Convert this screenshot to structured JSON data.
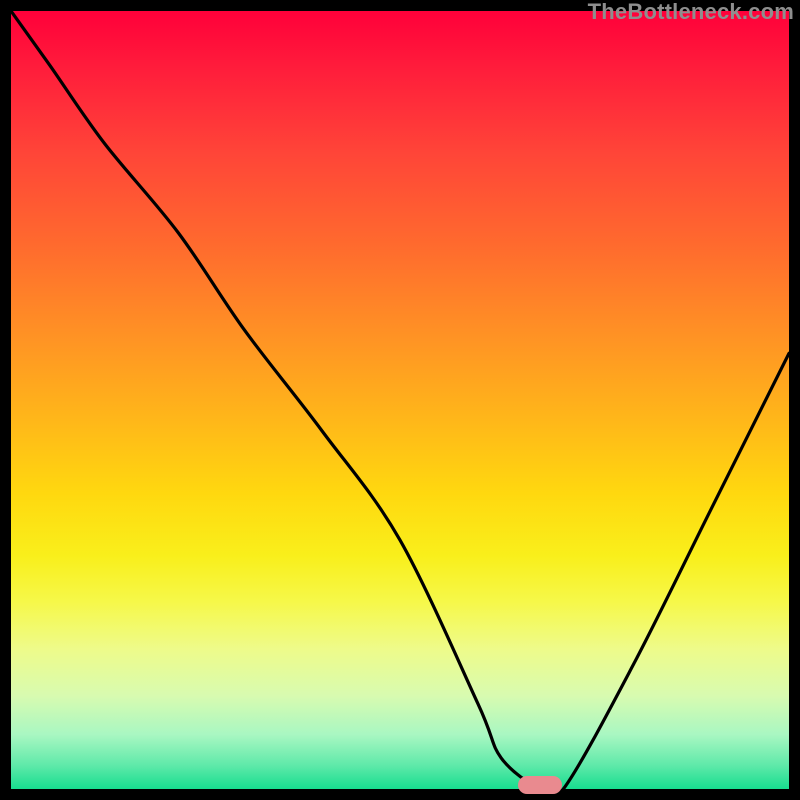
{
  "watermark": "TheBottleneck.com",
  "chart_data": {
    "type": "line",
    "title": "",
    "xlabel": "",
    "ylabel": "",
    "xlim": [
      0,
      100
    ],
    "ylim": [
      0,
      100
    ],
    "grid": false,
    "legend": false,
    "background": "rainbow-vertical-gradient",
    "series": [
      {
        "name": "bottleneck-curve",
        "x": [
          0,
          5,
          12,
          21.5,
          30,
          40,
          50,
          60,
          63,
          68,
          71,
          80,
          90,
          100
        ],
        "values": [
          100,
          93,
          83,
          71.5,
          59,
          46,
          32,
          11,
          4,
          0,
          0,
          16,
          36,
          56
        ]
      }
    ],
    "annotations": [
      {
        "name": "valley-marker",
        "x": 68,
        "y": 0.5,
        "shape": "rounded-rect",
        "color": "#e98a8f"
      }
    ]
  }
}
